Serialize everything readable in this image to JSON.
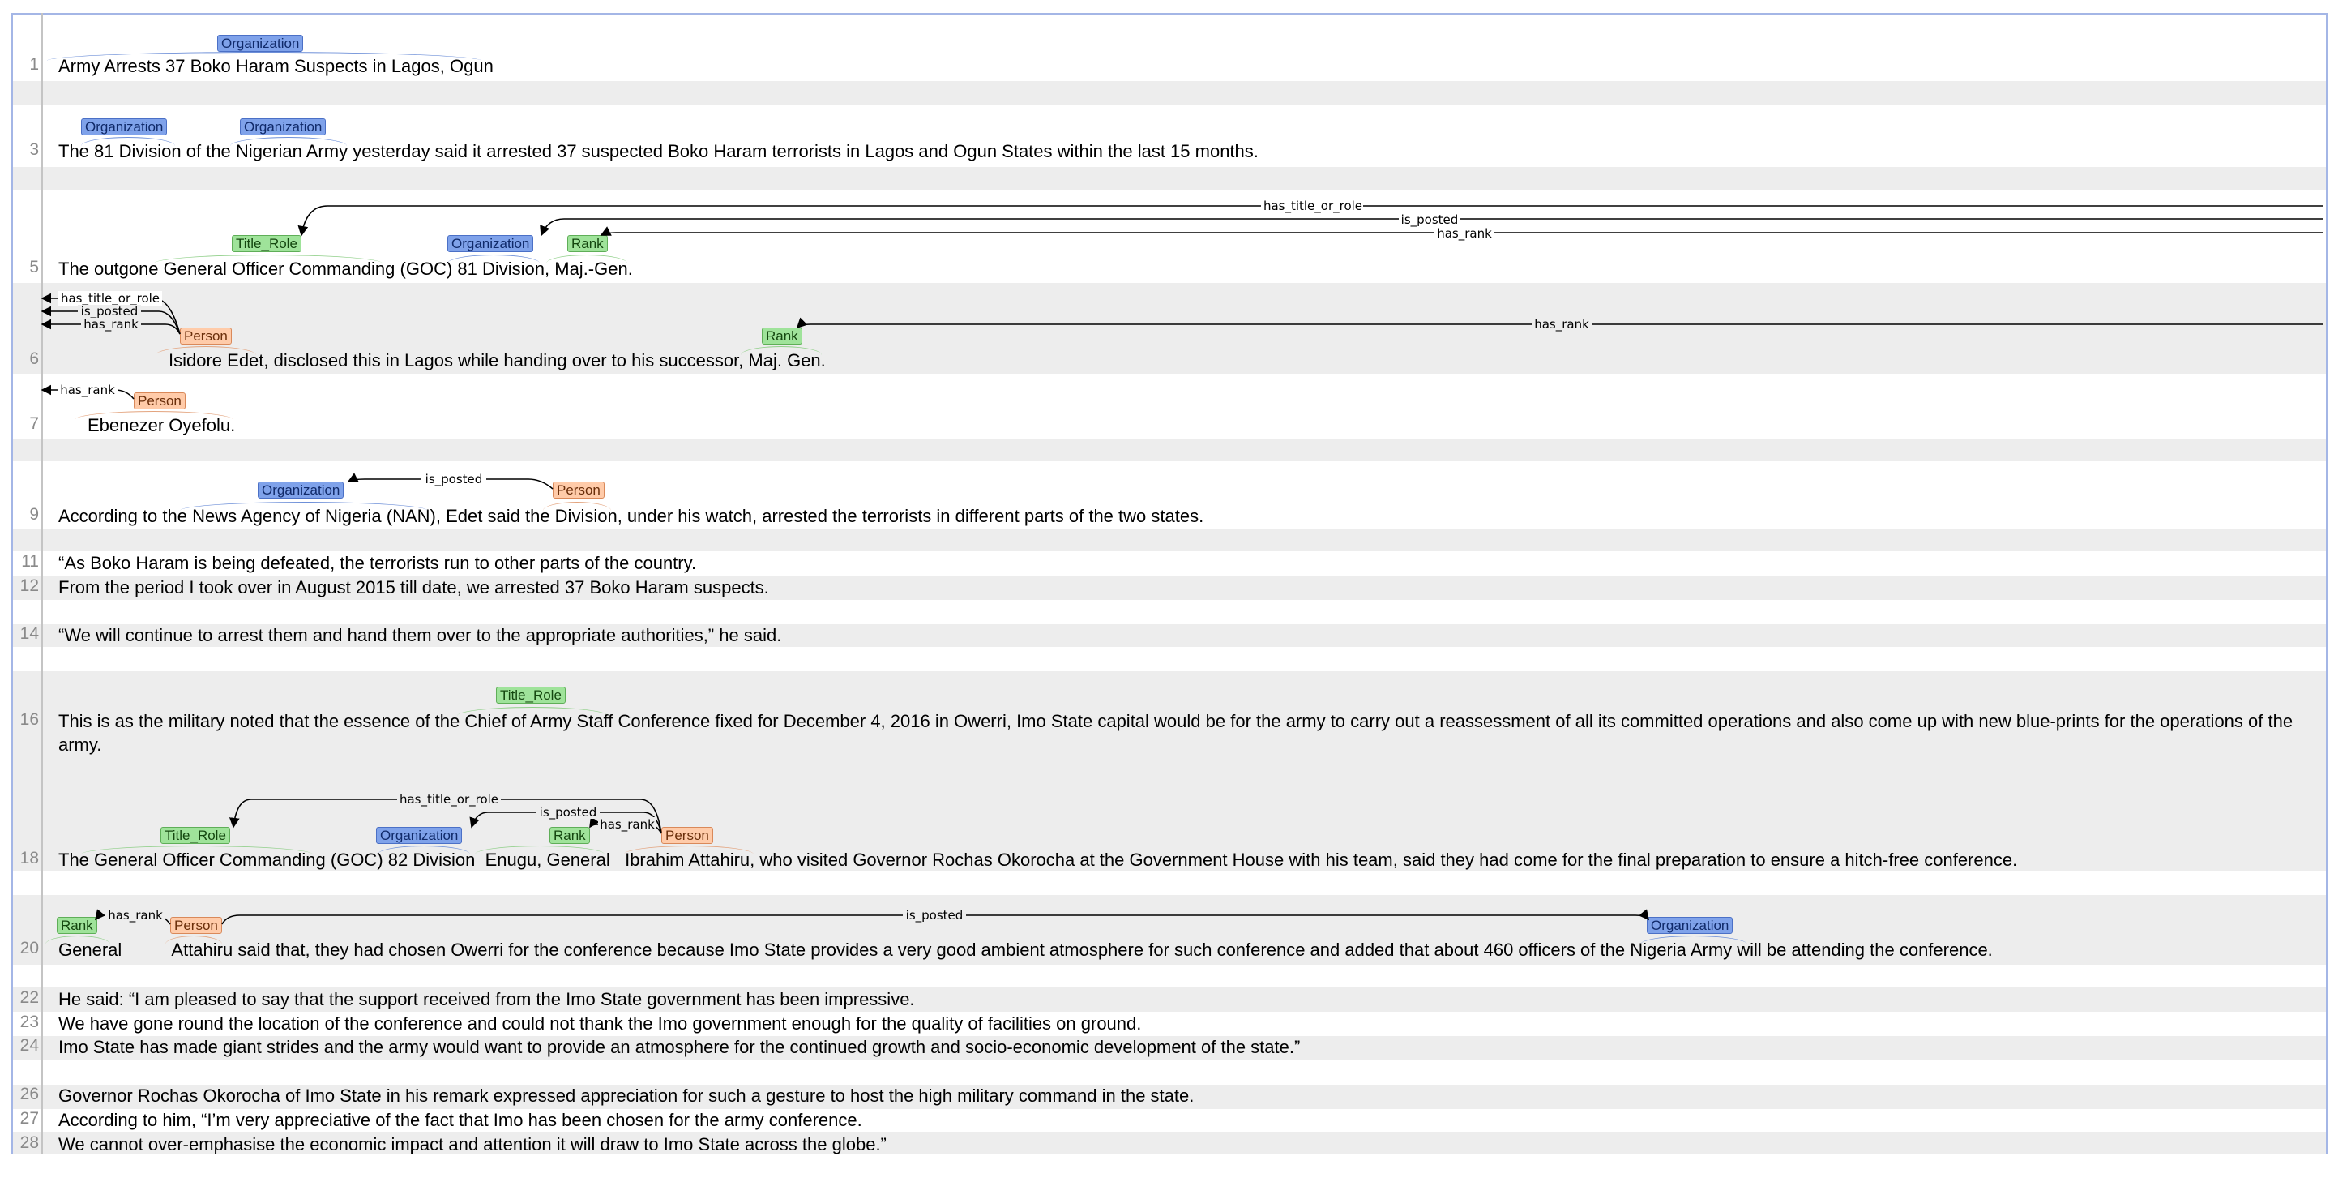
{
  "lines": [
    {
      "n": "1",
      "text": "Army Arrests 37 Boko Haram Suspects in Lagos, Ogun"
    },
    {
      "n": "3",
      "pre": "The ",
      "e1": "81 Division",
      "mid1": " of the ",
      "e2": "Nigerian Army",
      "post": " yesterday said it arrested 37 suspected Boko Haram terrorists in Lagos and Ogun States within the last 15 months."
    },
    {
      "n": "5",
      "pre": "The outgone ",
      "e1": "General Officer Commanding",
      "mid1": " (GOC) ",
      "e2": "81 Division",
      "mid2": ", ",
      "e3": "Maj.-Gen."
    },
    {
      "n": "6",
      "e1": "Isidore Edet",
      "mid1": ", disclosed this in Lagos while handing over to his successor, ",
      "e2": "Maj. Gen."
    },
    {
      "n": "7",
      "e1": "Ebenezer Oyefolu."
    },
    {
      "n": "9",
      "pre": "According to the ",
      "e1": "News Agency of Nigeria (NAN)",
      "mid1": ", ",
      "e2": "Edet",
      "mid2": " said the Division, under his watch, arrested the terrorists in different parts of the two states."
    },
    {
      "n": "11",
      "text": "“As Boko Haram is being defeated, the terrorists run to other parts of the country."
    },
    {
      "n": "12",
      "text": "From the period I took over in August 2015 till date, we arrested 37 Boko Haram suspects."
    },
    {
      "n": "14",
      "text": "“We will continue to arrest them and hand them over to the appropriate authorities,” he said."
    },
    {
      "n": "16",
      "pre": "This is as the military noted that the essence of the ",
      "e1": "Chief of Army Staff",
      "post": " Conference fixed for December 4, 2016 in Owerri, Imo State capital would be for the army to carry out a reassessment of all its committed operations and also come up with new blue-prints for the operations of the army."
    },
    {
      "n": "18",
      "pre": "The ",
      "e1": "General Officer Commanding",
      "mid1": " (GOC) ",
      "e2": "82 Division",
      "mid2": "  Enugu, ",
      "e3": "General",
      "mid3": "   ",
      "e4": "Ibrahim Attahiru",
      "post": ", who visited Governor Rochas Okorocha at the Government House with his team, said they had come for the final preparation to ensure a hitch-free conference."
    },
    {
      "n": "20",
      "e1": "General",
      "mid1": "          ",
      "e2": "Attahiru",
      "mid2": " said that, they had chosen Owerri for the conference because Imo State provides a very good ambient atmosphere for such conference and added that about 460 officers of the ",
      "e3": "Nigeria Army",
      "post": " will be attending the conference."
    },
    {
      "n": "22",
      "text": "He said: “I am pleased to say that the support received from the Imo State government has been impressive."
    },
    {
      "n": "23",
      "text": "We have gone round the location of the conference and could not thank the Imo government enough for the quality of facilities on ground."
    },
    {
      "n": "24",
      "text": "Imo State has made giant strides and the army would want to provide an atmosphere for the continued growth and socio-economic development of the state.”"
    },
    {
      "n": "26",
      "text": "Governor Rochas Okorocha of Imo State in his remark expressed appreciation for such a gesture to host the high military command in the state."
    },
    {
      "n": "27",
      "text": "According to him, “I’m very appreciative of the fact that Imo has been chosen for the army conference."
    },
    {
      "n": "28",
      "text": "We cannot over-emphasise the economic impact and attention it will draw to Imo State across the globe.”"
    }
  ],
  "entity_types": {
    "org": "Organization",
    "per": "Person",
    "rank": "Rank",
    "role": "Title_Role"
  },
  "relations": {
    "title": "has_title_or_role",
    "posted": "is_posted",
    "rank": "has_rank"
  },
  "colors": {
    "org": "#7fa2ea",
    "person": "#ffcba9",
    "rank": "#9fe39a",
    "frame": "#a4b6e6",
    "row_shade": "#ededed"
  }
}
